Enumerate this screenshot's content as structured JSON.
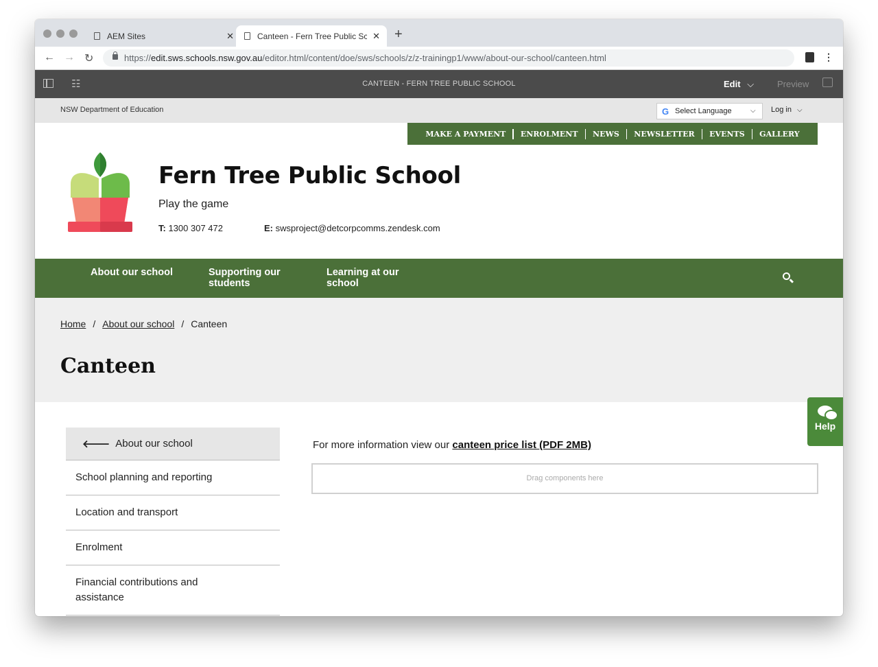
{
  "browser": {
    "tabs": [
      {
        "title": "AEM Sites",
        "active": false
      },
      {
        "title": "Canteen - Fern Tree Public Sch",
        "active": true
      }
    ],
    "new_tab": "+",
    "url_prefix": "https://",
    "url_host": "edit.sws.schools.nsw.gov.au",
    "url_path": "/editor.html/content/doe/sws/schools/z/z-trainingp1/www/about-our-school/canteen.html"
  },
  "aem": {
    "page_title": "CANTEEN - FERN TREE PUBLIC SCHOOL",
    "edit_label": "Edit",
    "preview_label": "Preview"
  },
  "utility": {
    "department": "NSW Department of Education",
    "language_label": "Select Language",
    "login_label": "Log in"
  },
  "quick_nav": [
    "MAKE A PAYMENT",
    "ENROLMENT",
    "NEWS",
    "NEWSLETTER",
    "EVENTS",
    "GALLERY"
  ],
  "school": {
    "name": "Fern Tree Public School",
    "tagline": "Play the game",
    "phone_label": "T:",
    "phone": "1300 307 472",
    "email_label": "E:",
    "email": "swsproject@detcorpcomms.zendesk.com"
  },
  "main_nav": [
    {
      "label": "About our school"
    },
    {
      "label": "Supporting our students"
    },
    {
      "label": "Learning at our school"
    }
  ],
  "breadcrumb": [
    {
      "label": "Home"
    },
    {
      "label": "About our school"
    },
    {
      "label": "Canteen"
    }
  ],
  "page_heading": "Canteen",
  "side_nav": {
    "back_label": "About our school",
    "items": [
      "School planning and reporting",
      "Location and transport",
      "Enrolment",
      "Financial contributions and assistance"
    ]
  },
  "content": {
    "intro_text": "For more information view our",
    "link_text": "canteen price list (PDF 2MB)",
    "dropzone_text": "Drag components here"
  },
  "help_label": "Help",
  "colors": {
    "brand_green": "#4b7039",
    "help_green": "#4b8a3a",
    "aem_bar": "#4b4b4b"
  }
}
